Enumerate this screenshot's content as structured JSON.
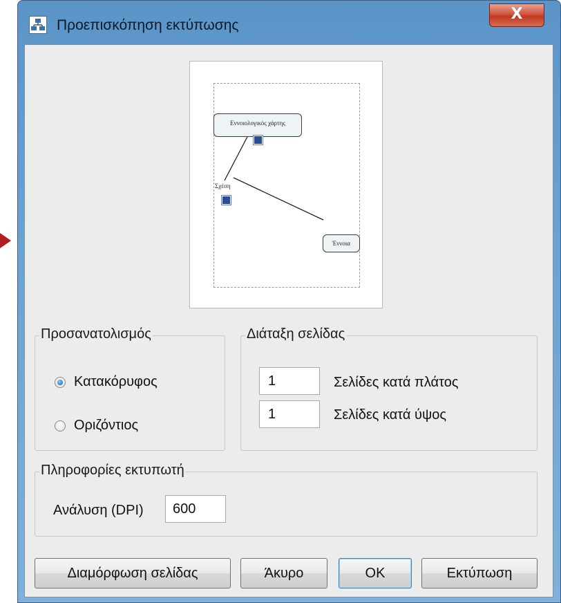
{
  "window": {
    "title": "Προεπισκόπηση εκτύπωσης",
    "close_glyph": "X"
  },
  "preview": {
    "nodes": {
      "concept_map": "Εννοιολογικός χάρτης",
      "concept": "Έννοια"
    },
    "link_label": "Σχέση"
  },
  "orientation": {
    "legend": "Προσανατολισμός",
    "portrait": "Κατακόρυφος",
    "landscape": "Οριζόντιος",
    "selected": "portrait"
  },
  "page_layout": {
    "legend": "Διάταξη σελίδας",
    "pages_wide_value": "1",
    "pages_wide_label": "Σελίδες κατά πλάτος",
    "pages_tall_value": "1",
    "pages_tall_label": "Σελίδες κατά ύψος"
  },
  "printer_info": {
    "legend": "Πληροφορίες εκτυπωτή",
    "resolution_label": "Ανάλυση (DPI)",
    "resolution_value": "600"
  },
  "buttons": {
    "page_setup": "Διαμόρφωση σελίδας",
    "cancel": "Άκυρο",
    "ok": "OK",
    "print": "Εκτύπωση"
  },
  "colors": {
    "accent_arrow": "#b11f1f",
    "title_bar": "#6aa2d2",
    "close_button": "#c2371f"
  }
}
